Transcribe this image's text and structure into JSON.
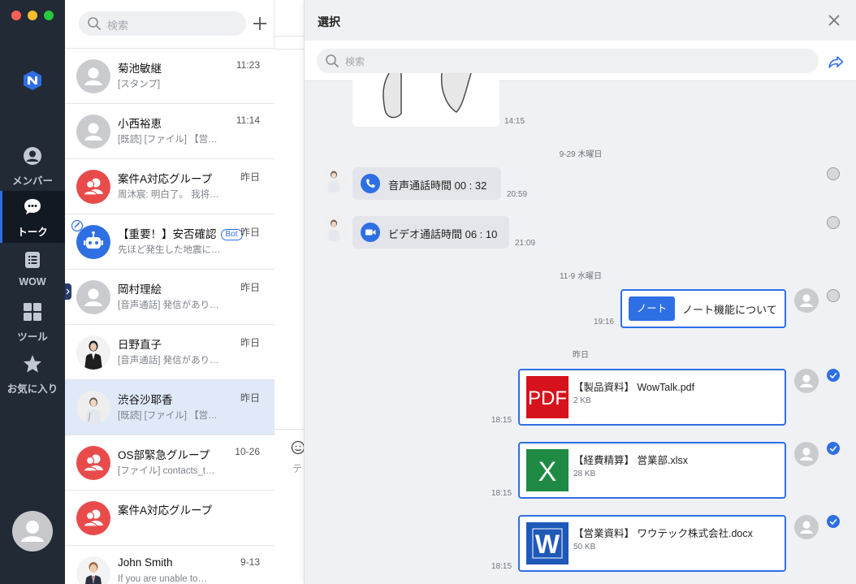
{
  "colors": {
    "accent": "#2f6fe4",
    "nav_bg": "#222a36",
    "danger": "#e94b4b"
  },
  "nav": {
    "items": [
      {
        "label": "メンバー",
        "icon": "person-icon"
      },
      {
        "label": "トーク",
        "icon": "chat-bubble-icon",
        "active": true
      },
      {
        "label": "WOW",
        "icon": "note-list-icon"
      },
      {
        "label": "ツール",
        "icon": "grid-icon"
      },
      {
        "label": "お気に入り",
        "icon": "star-icon"
      }
    ]
  },
  "list": {
    "search_placeholder": "検索",
    "rows": [
      {
        "name": "菊池敏継",
        "time": "11:23",
        "preview": "[スタンプ]"
      },
      {
        "name": "小西裕恵",
        "time": "11:14",
        "preview": "[既読] [ファイル] 【営…"
      },
      {
        "name": "案件A対応グループ",
        "time": "昨日",
        "preview": "周沐宸: 明白了。 我将…"
      },
      {
        "name": "【重要！】安否確認",
        "badge": "Bot",
        "time": "昨日",
        "preview": "先ほど発生した地震に…"
      },
      {
        "name": "岡村理絵",
        "time": "昨日",
        "preview": "[音声通話] 発信があり…"
      },
      {
        "name": "日野直子",
        "time": "昨日",
        "preview": "[音声通話] 発信があり…"
      },
      {
        "name": "渋谷沙耶香",
        "time": "昨日",
        "preview": "[既読] [ファイル] 【営…"
      },
      {
        "name": "OS部緊急グループ",
        "time": "10-26",
        "preview": "[ファイル] contacts_t…"
      },
      {
        "name": "案件A対応グループ",
        "time": "",
        "preview": ""
      },
      {
        "name": "John Smith",
        "time": "9-13",
        "preview": "If you are unable to…"
      }
    ]
  },
  "panel": {
    "title": "選択",
    "search_placeholder": "検索",
    "sticker_time": "14:15",
    "date1": "9-29 木曜日",
    "voice_call": {
      "text": "音声通話時間 00 : 32",
      "time": "20:59"
    },
    "video_call": {
      "text": "ビデオ通話時間 06 : 10",
      "time": "21:09"
    },
    "date2": "11-9 水曜日",
    "note": {
      "button": "ノート",
      "text": "ノート機能について",
      "time": "19:16"
    },
    "date3": "昨日",
    "files": [
      {
        "name": "【製品資料】 WowTalk.pdf",
        "size": "2 KB",
        "time": "18:15",
        "icon_label": "PDF"
      },
      {
        "name": "【経費精算】 営業部.xlsx",
        "size": "28 KB",
        "time": "18:15",
        "icon_label": "X"
      },
      {
        "name": "【営業資料】 ワウテック株式会社.docx",
        "size": "50 KB",
        "time": "18:15",
        "icon_label": "W"
      }
    ]
  },
  "chat_bg": {
    "composer_hint": "テ"
  }
}
